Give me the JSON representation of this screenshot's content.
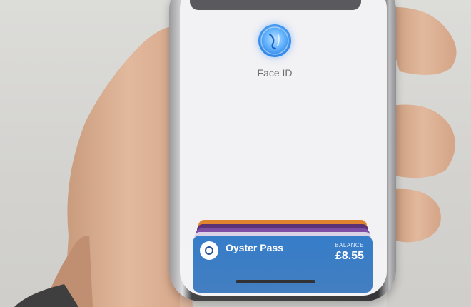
{
  "face_id": {
    "label": "Face ID",
    "icon": "face-id-icon"
  },
  "wallet": {
    "card": {
      "name": "Oyster Pass",
      "balance_label": "BALANCE",
      "balance_value": "£8.55"
    },
    "stack_colors": [
      "#e0822c",
      "#5a2f73",
      "#7b4aa3",
      "#d9d2e6"
    ]
  }
}
